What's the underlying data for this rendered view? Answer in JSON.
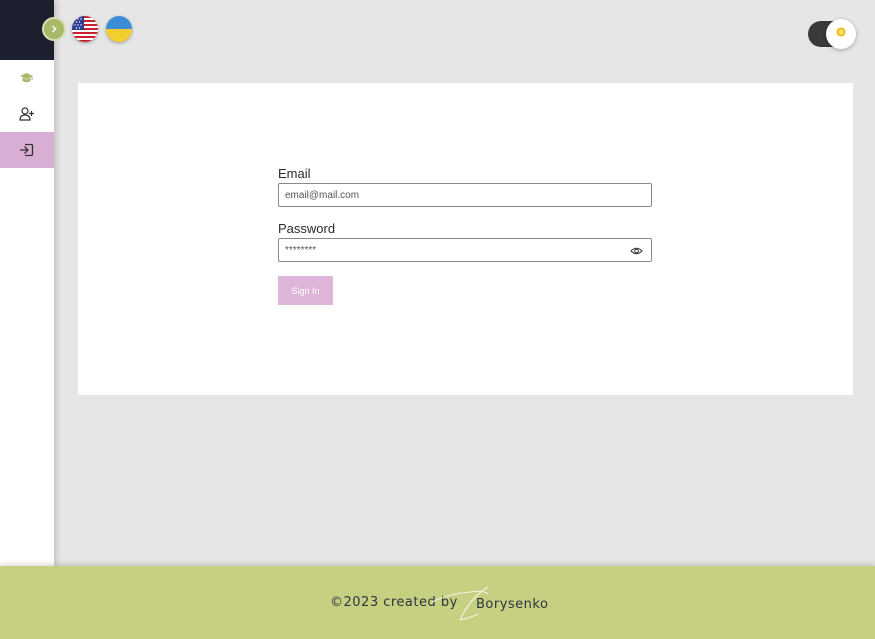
{
  "app": {
    "colors": {
      "sidebar_header": "#1c1f2e",
      "accent_green": "#a9b96a",
      "active_item": "#d9aed4",
      "footer": "#c6d080",
      "sign_in_button": "#dfb6da",
      "theme_track": "#3a3a3a",
      "sun": "#f5b800"
    }
  },
  "sidebar": {
    "items": [
      {
        "icon": "graduation-cap-icon",
        "active": false
      },
      {
        "icon": "add-user-icon",
        "active": false
      },
      {
        "icon": "sign-in-icon",
        "active": true
      }
    ],
    "collapse_icon": "chevron-right-icon"
  },
  "topbar": {
    "languages": [
      {
        "code": "en",
        "icon": "us-flag-icon"
      },
      {
        "code": "uk",
        "icon": "ukraine-flag-icon"
      }
    ],
    "theme_toggle": {
      "icon": "sun-icon",
      "mode": "light"
    }
  },
  "login": {
    "email": {
      "label": "Email",
      "placeholder": "email@mail.com",
      "value": ""
    },
    "password": {
      "label": "Password",
      "placeholder": "********",
      "value": ""
    },
    "eye_icon": "eye-icon",
    "submit_label": "Sign In"
  },
  "footer": {
    "copyright": "©2023 created by",
    "author": "Borysenko",
    "signature_icon": "signature-icon"
  }
}
